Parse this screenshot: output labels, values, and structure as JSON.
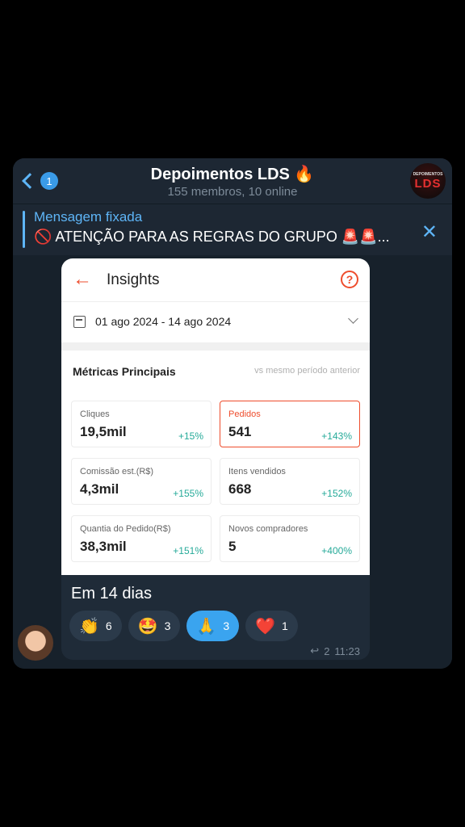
{
  "header": {
    "back_count": "1",
    "title": "Depoimentos LDS 🔥",
    "subtitle": "155 membros, 10 online",
    "avatar_small": "DEPOIMENTOS",
    "avatar_big": "LDS"
  },
  "pinned": {
    "label": "Mensagem fixada",
    "text": "🚫 ATENÇÃO PARA AS REGRAS DO GRUPO 🚨🚨...",
    "close": "✕"
  },
  "screenshot": {
    "back": "←",
    "title": "Insights",
    "help": "?",
    "date_range": "01 ago 2024 - 14 ago 2024",
    "metrics_title": "Métricas Principais",
    "compare": "vs mesmo período anterior",
    "cards": [
      {
        "label": "Cliques",
        "value": "19,5mil",
        "delta": "+15%"
      },
      {
        "label": "Pedidos",
        "value": "541",
        "delta": "+143%"
      },
      {
        "label": "Comissão est.(R$)",
        "value": "4,3mil",
        "delta": "+155%"
      },
      {
        "label": "Itens vendidos",
        "value": "668",
        "delta": "+152%"
      },
      {
        "label": "Quantia do Pedido(R$)",
        "value": "38,3mil",
        "delta": "+151%"
      },
      {
        "label": "Novos compradores",
        "value": "5",
        "delta": "+400%"
      }
    ]
  },
  "message": {
    "caption": "Em 14 dias",
    "reactions": [
      {
        "emoji": "👏",
        "count": "6"
      },
      {
        "emoji": "🤩",
        "count": "3"
      },
      {
        "emoji": "🙏",
        "count": "3"
      },
      {
        "emoji": "❤️",
        "count": "1"
      }
    ],
    "replies": "2",
    "time": "11:23"
  },
  "colors": {
    "accent": "#5eb5f7",
    "shopee_orange": "#ee4d2d",
    "positive": "#26aa99"
  }
}
